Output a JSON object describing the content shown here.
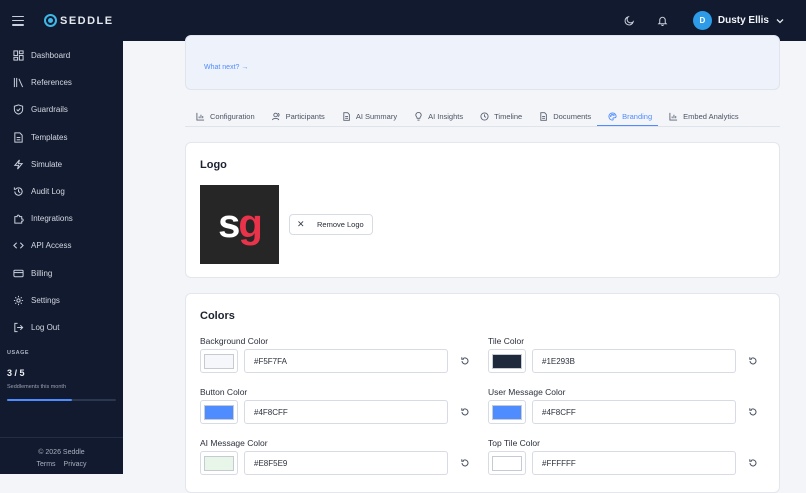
{
  "brand": {
    "name": "SEDDLE"
  },
  "sidebar": {
    "items": [
      {
        "label": "Dashboard",
        "icon": "dashboard-icon"
      },
      {
        "label": "References",
        "icon": "library-icon"
      },
      {
        "label": "Guardrails",
        "icon": "shield-check-icon"
      },
      {
        "label": "Templates",
        "icon": "document-icon"
      },
      {
        "label": "Simulate",
        "icon": "lightning-icon"
      },
      {
        "label": "Audit Log",
        "icon": "history-icon"
      },
      {
        "label": "Integrations",
        "icon": "puzzle-icon"
      },
      {
        "label": "API Access",
        "icon": "code-icon"
      },
      {
        "label": "Billing",
        "icon": "credit-card-icon"
      },
      {
        "label": "Settings",
        "icon": "gear-icon"
      },
      {
        "label": "Log Out",
        "icon": "logout-icon"
      }
    ],
    "usage": {
      "title": "USAGE",
      "count": "3 / 5",
      "subtitle": "Seddlements this month",
      "progress_fraction": 0.6
    },
    "footer": {
      "copyright": "© 2026 Seddle",
      "terms": "Terms",
      "privacy": "Privacy"
    }
  },
  "topbar": {
    "user": {
      "initial": "D",
      "name": "Dusty Ellis"
    }
  },
  "main": {
    "what_next": "What next? →",
    "tabs": [
      {
        "label": "Configuration",
        "active": false
      },
      {
        "label": "Participants",
        "active": false
      },
      {
        "label": "AI Summary",
        "active": false
      },
      {
        "label": "AI Insights",
        "active": false
      },
      {
        "label": "Timeline",
        "active": false
      },
      {
        "label": "Documents",
        "active": false
      },
      {
        "label": "Branding",
        "active": true
      },
      {
        "label": "Embed Analytics",
        "active": false
      }
    ],
    "logo_card": {
      "title": "Logo",
      "remove_label": "Remove Logo"
    },
    "colors_card": {
      "title": "Colors",
      "fields": [
        {
          "label": "Background Color",
          "value": "#F5F7FA"
        },
        {
          "label": "Tile Color",
          "value": "#1E293B"
        },
        {
          "label": "Button Color",
          "value": "#4F8CFF"
        },
        {
          "label": "User Message Color",
          "value": "#4F8CFF"
        },
        {
          "label": "AI Message Color",
          "value": "#E8F5E9"
        },
        {
          "label": "Top Tile Color",
          "value": "#FFFFFF"
        }
      ]
    }
  },
  "colors": {
    "sidebar_bg": "#111a2e",
    "accent": "#4f8cff",
    "logo_red": "#e8334a",
    "avatar": "#2d9be8"
  }
}
